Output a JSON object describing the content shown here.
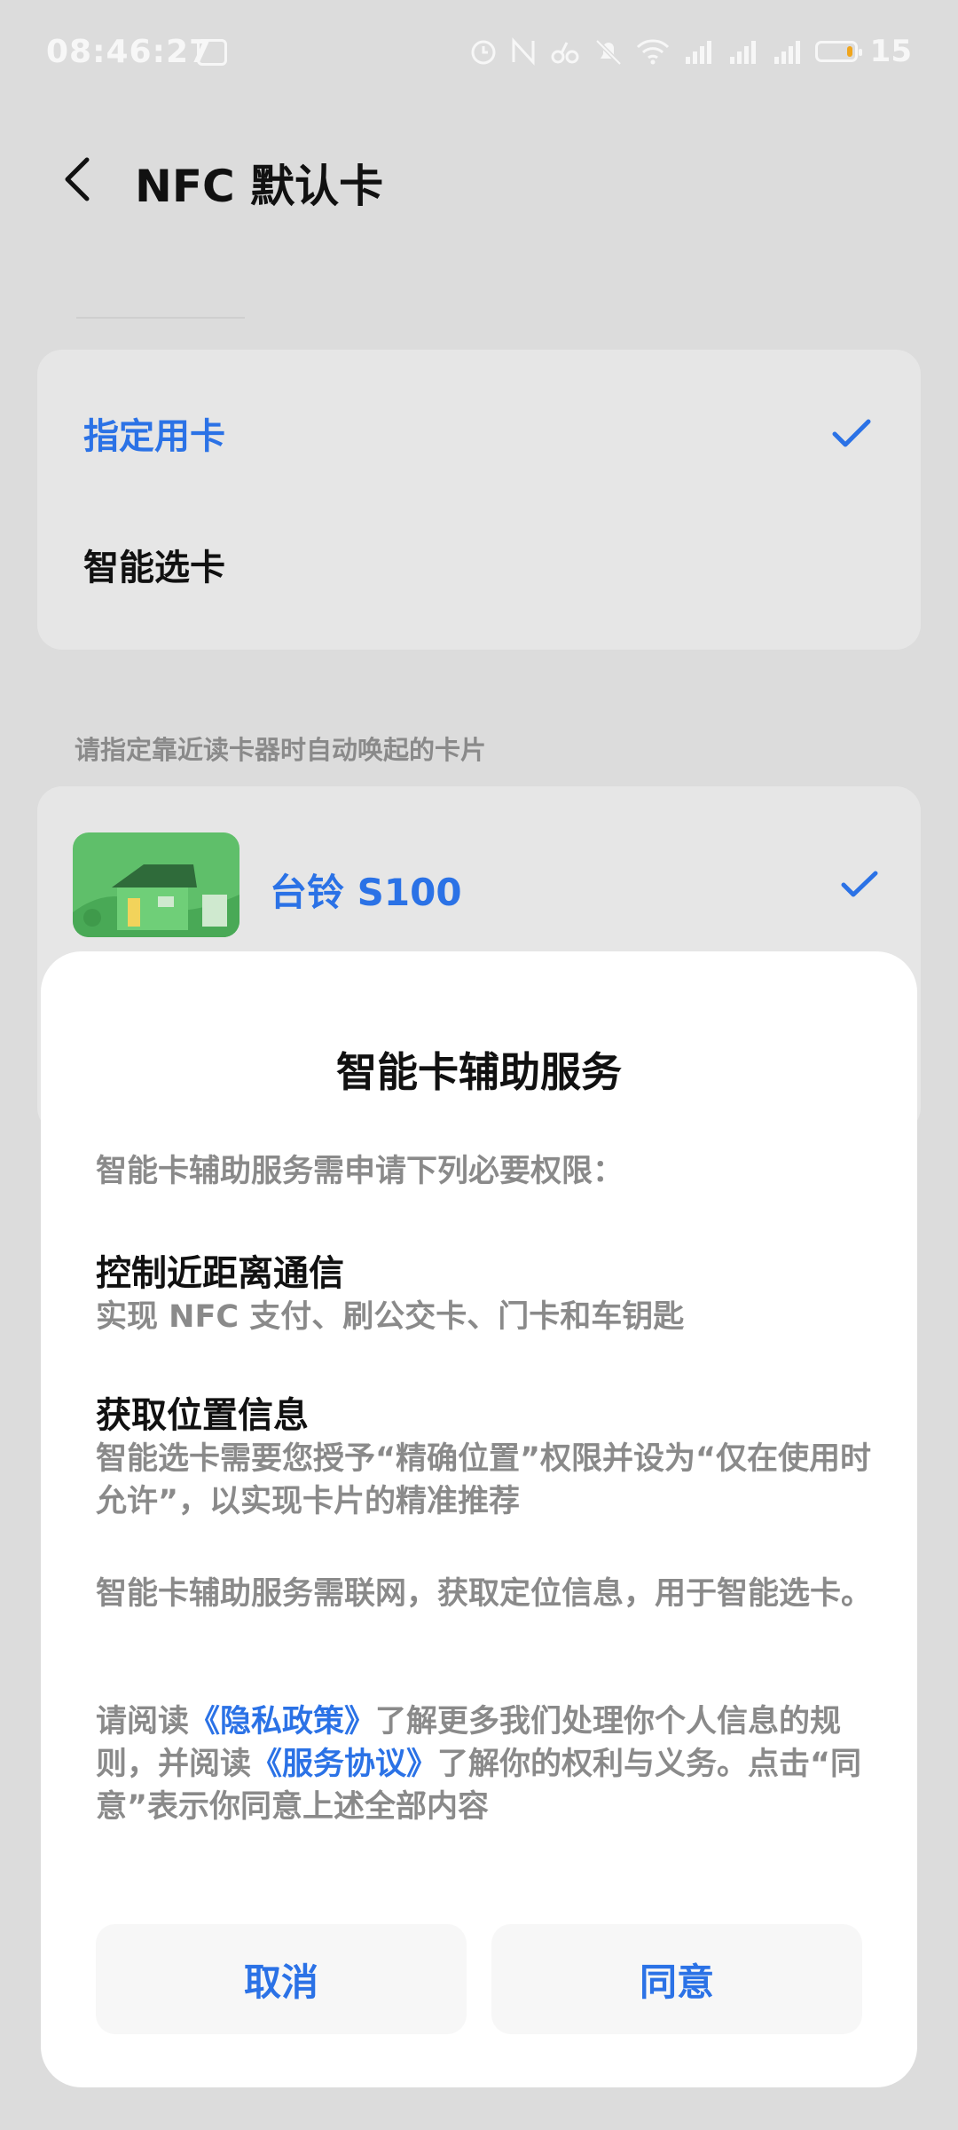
{
  "status_bar": {
    "time": "08:46:27",
    "battery_percent": "15",
    "battery_level": 0.15,
    "icons": [
      "weibo-icon",
      "alarm-icon",
      "nfc-icon",
      "link-icon",
      "mute-icon",
      "wifi-icon",
      "signal-4g-icon",
      "signal-4g-icon",
      "signal-icon",
      "battery-icon"
    ]
  },
  "header": {
    "title": "NFC 默认卡"
  },
  "mode": {
    "items": [
      {
        "label": "指定用卡",
        "selected": true
      },
      {
        "label": "智能选卡",
        "selected": false
      }
    ]
  },
  "section_hint": "请指定靠近读卡器时自动唤起的卡片",
  "cards": [
    {
      "name": "台铃 S100",
      "selected": true
    }
  ],
  "dialog": {
    "title": "智能卡辅助服务",
    "intro": "智能卡辅助服务需申请下列必要权限：",
    "permissions": [
      {
        "title": "控制近距离通信",
        "desc": "实现 NFC 支付、刷公交卡、门卡和车钥匙"
      },
      {
        "title": "获取位置信息",
        "desc": "智能选卡需要您授予“精确位置”权限并设为“仅在使用时允许”，以实现卡片的精准推荐"
      }
    ],
    "network_note": "智能卡辅助服务需联网，获取定位信息，用于智能选卡。",
    "privacy": {
      "part1": "请阅读",
      "privacy_link": "《隐私政策》",
      "part2": "了解更多我们处理你个人信息的规则，并阅读",
      "terms_link": "《服务协议》",
      "part3": "了解你的权利与义务。点击“同意”表示你同意上述全部内容"
    },
    "cancel_label": "取消",
    "agree_label": "同意"
  },
  "colors": {
    "accent": "#2b72e6",
    "background": "#dcdcdc",
    "card": "#e6e6e6",
    "dialog": "#ffffff"
  }
}
